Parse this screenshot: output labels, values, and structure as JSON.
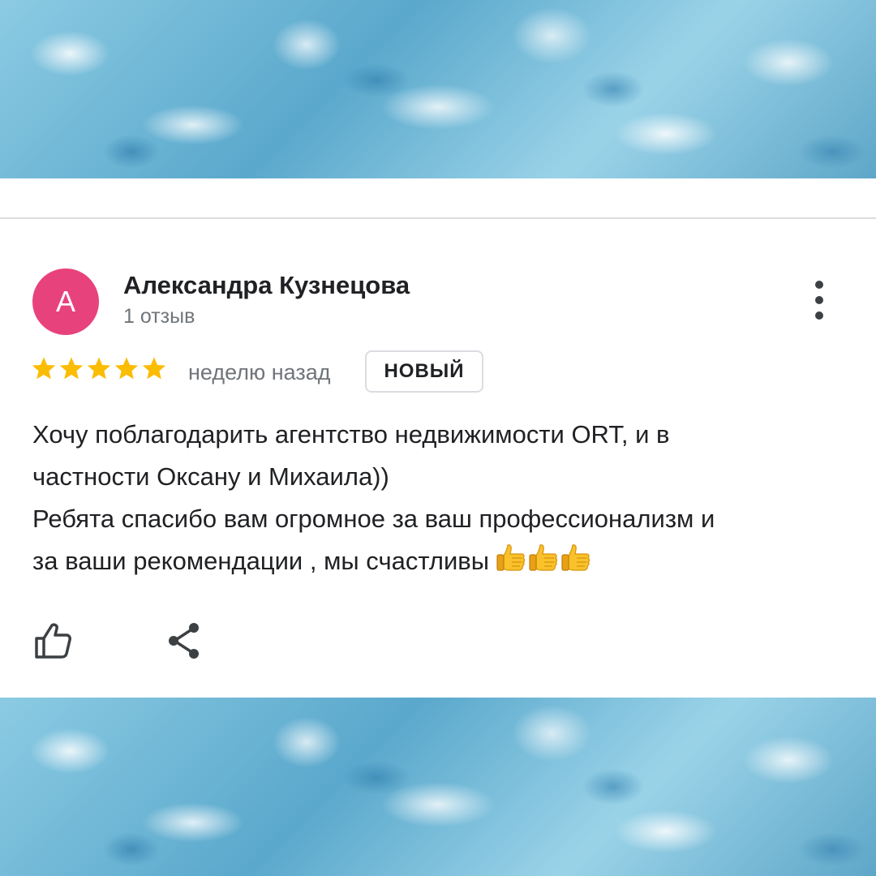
{
  "review": {
    "avatar_letter": "А",
    "author_name": "Александра Кузнецова",
    "review_count": "1 отзыв",
    "rating": 5,
    "rating_max": 5,
    "time_ago": "неделю назад",
    "badge": "НОВЫЙ",
    "text_lines": [
      "Хочу поблагодарить агентство недвижимости ORT, и в",
      "частности Оксану и Михаила))",
      "Ребята спасибо вам огромное за ваш профессионализм и",
      "за ваши рекомендации , мы счастливы"
    ],
    "emoji": "👍👍👍"
  },
  "icons": {
    "menu": "more-vert-icon",
    "like": "thumb-up-icon",
    "share": "share-icon",
    "star": "star-icon"
  },
  "colors": {
    "avatar_bg": "#e8427c",
    "star": "#fbbc04",
    "text_primary": "#202124",
    "text_secondary": "#70757a",
    "divider": "#dadce0"
  }
}
